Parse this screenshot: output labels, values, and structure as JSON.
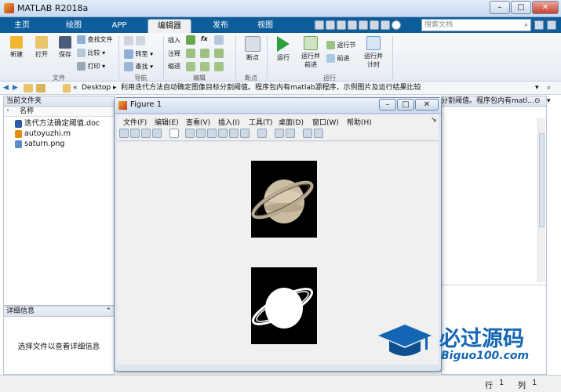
{
  "app": {
    "title": "MATLAB R2018a"
  },
  "window_controls": {
    "minimize": "–",
    "maximize": "□",
    "close": "✕"
  },
  "tabs": [
    "主页",
    "绘图",
    "APP",
    "编辑器",
    "发布",
    "视图"
  ],
  "search": {
    "placeholder": "搜索文档"
  },
  "ribbon": {
    "file": {
      "new": "新建",
      "open": "打开",
      "save": "保存",
      "find_files": "查找文件",
      "compare": "比较",
      "print": "打印",
      "group": "文件"
    },
    "nav": {
      "goto": "转至",
      "find": "查找",
      "group": "导航"
    },
    "edit": {
      "insert": "插入",
      "fx": "fx",
      "comment": "注释",
      "indent": "缩进",
      "group": "编辑"
    },
    "breakpoints": {
      "label": "断点",
      "group": "断点"
    },
    "run": {
      "run": "运行",
      "run_advance_1": "运行并",
      "run_advance_2": "前进",
      "run_section": "运行节",
      "advance": "前进",
      "run_time_1": "运行并",
      "run_time_2": "计时",
      "group": "运行"
    }
  },
  "address": {
    "sep": "«",
    "desktop": "Desktop",
    "arrow": "▸",
    "folder": "利用迭代方法自动确定图像目标分割阈值。程序包内有matlab源程序，示例图片及运行结果比较"
  },
  "current_folder": {
    "title": "当前文件夹",
    "column": "名称",
    "files": [
      "迭代方法确定阈值.doc",
      "autoyuzhi.m",
      "saturn.png"
    ]
  },
  "details": {
    "title": "详细信息",
    "empty": "选择文件以查看详细信息"
  },
  "right_pane": {
    "text": "分割阈值。程序包内有matl..."
  },
  "figure": {
    "title": "Figure 1",
    "menus": [
      "文件(F)",
      "编辑(E)",
      "查看(V)",
      "插入(I)",
      "工具(T)",
      "桌面(D)",
      "窗口(W)",
      "帮助(H)"
    ]
  },
  "status": {
    "row_label": "行",
    "row": "1",
    "col_label": "列",
    "col": "1"
  },
  "watermark": {
    "cn": "必过源码",
    "en": "Biguo100.com"
  }
}
